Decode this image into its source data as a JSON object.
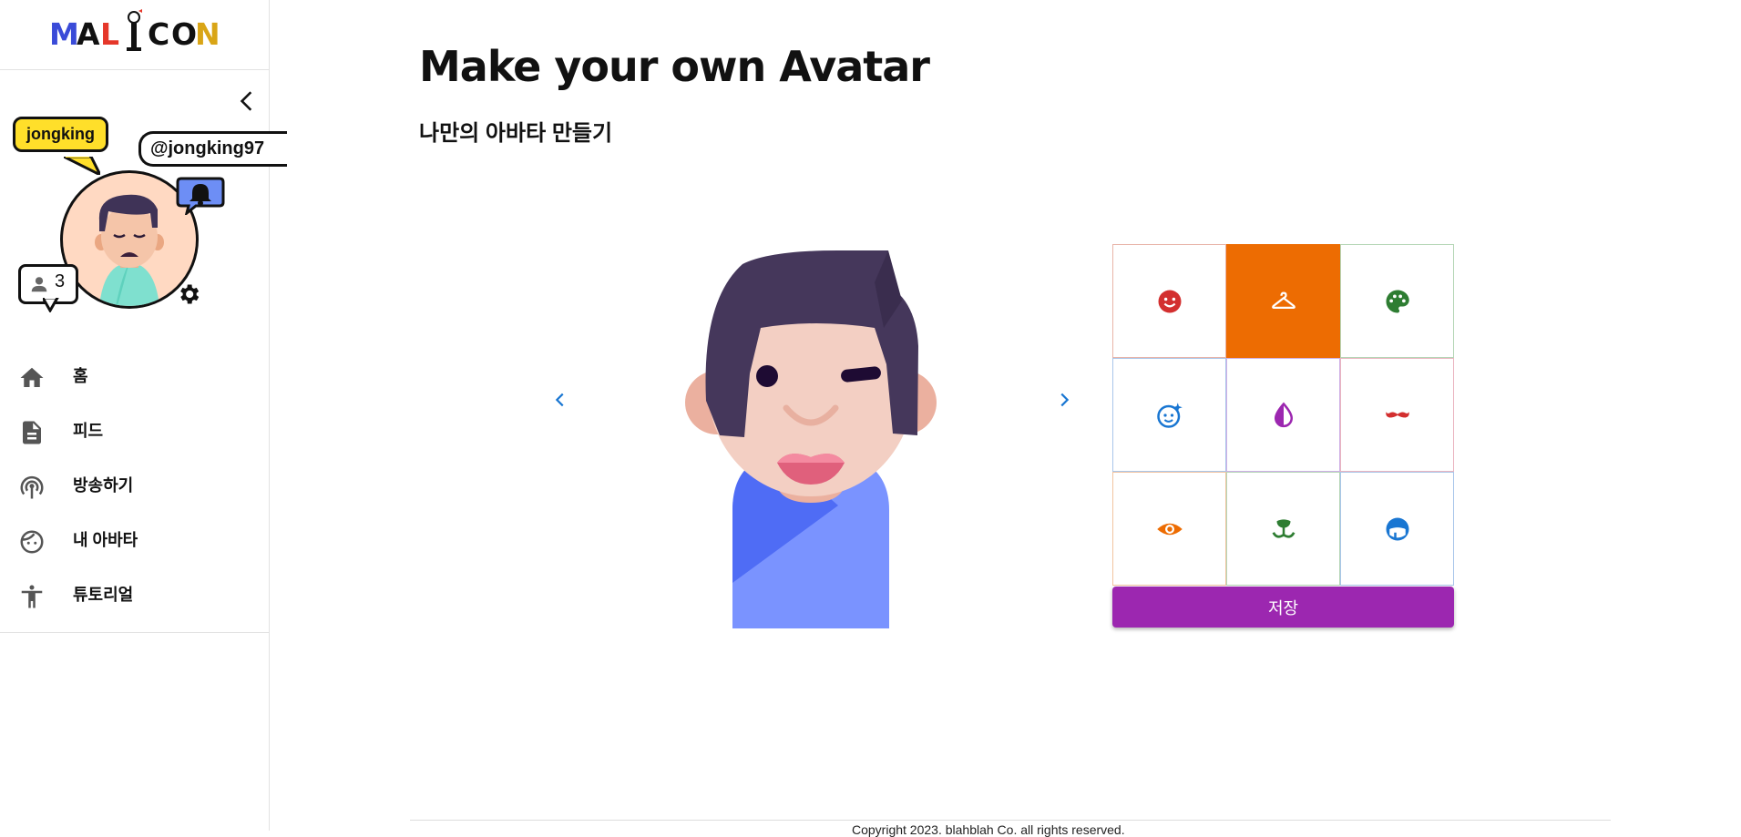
{
  "brand": {
    "logo_text": "MALICON"
  },
  "profile": {
    "name": "jongking",
    "handle": "@jongking97",
    "friend_count": "3"
  },
  "nav": {
    "items": [
      {
        "label": "홈",
        "icon": "home-icon"
      },
      {
        "label": "피드",
        "icon": "document-icon"
      },
      {
        "label": "방송하기",
        "icon": "broadcast-icon"
      },
      {
        "label": "내 아바타",
        "icon": "face-icon"
      },
      {
        "label": "튜토리얼",
        "icon": "accessibility-icon"
      }
    ]
  },
  "page": {
    "title": "Make your own Avatar",
    "subtitle": "나만의 아바타 만들기"
  },
  "editor": {
    "categories": [
      {
        "icon": "face-smile-icon",
        "color": "#d32f2f",
        "border": "#e8b4a8",
        "active": false
      },
      {
        "icon": "hanger-icon",
        "color": "#ffffff",
        "border": "#ed6c02",
        "active": true
      },
      {
        "icon": "palette-icon",
        "color": "#2e7d32",
        "border": "#b5d6b6",
        "active": false
      },
      {
        "icon": "face-sparkle-icon",
        "color": "#1976d2",
        "border": "#a9c6ea",
        "active": false
      },
      {
        "icon": "opacity-drop-icon",
        "color": "#9c27b0",
        "border": "#cfb0e6",
        "active": false
      },
      {
        "icon": "mustache-icon",
        "color": "#d32f2f",
        "border": "#eab5c0",
        "active": false
      },
      {
        "icon": "eye-icon",
        "color": "#ed6c02",
        "border": "#f2c4a0",
        "active": false
      },
      {
        "icon": "mouth-icon",
        "color": "#2e7d32",
        "border": "#b5d6b6",
        "active": false
      },
      {
        "icon": "head-hair-icon",
        "color": "#1976d2",
        "border": "#a9c6ea",
        "active": false
      }
    ],
    "save_label": "저장",
    "accent": "#9c27b0",
    "active_color": "#ed6c02"
  },
  "footer": {
    "copyright": "Copyright 2023. blahblah Co. all rights reserved."
  }
}
